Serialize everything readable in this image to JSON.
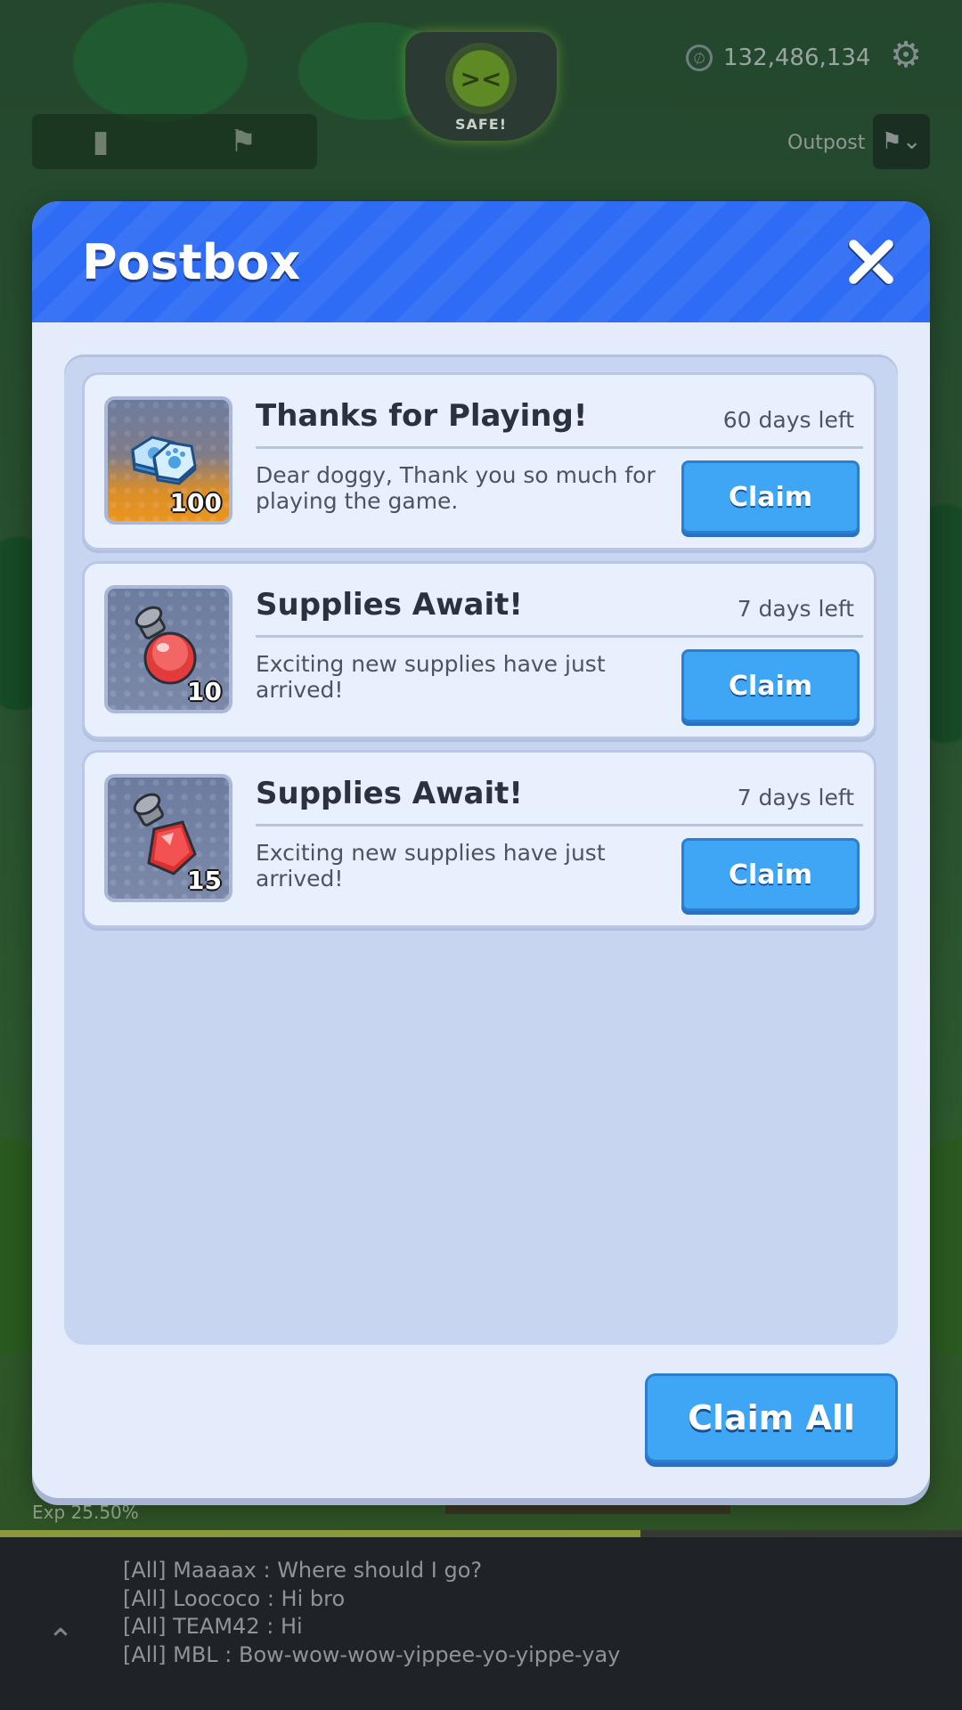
{
  "hud": {
    "safe_label": "SAFE!",
    "currency_value": "132,486,134",
    "outpost_label": "Outpost"
  },
  "postbox": {
    "title": "Postbox",
    "claim_all_label": "Claim All",
    "mails": [
      {
        "title": "Thanks for Playing!",
        "days_left": "60 days left",
        "body": "Dear doggy, Thank you so much for playing the game.",
        "item_icon": "paw-token-icon",
        "item_count": "100",
        "claim_label": "Claim"
      },
      {
        "title": "Supplies Await!",
        "days_left": "7 days left",
        "body": "Exciting new supplies have just arrived!",
        "item_icon": "round-red-potion-icon",
        "item_count": "10",
        "claim_label": "Claim"
      },
      {
        "title": "Supplies Await!",
        "days_left": "7 days left",
        "body": "Exciting new supplies have just arrived!",
        "item_icon": "square-red-potion-icon",
        "item_count": "15",
        "claim_label": "Claim"
      }
    ]
  },
  "exp": {
    "label": "Exp 25.50%",
    "fraction": 0.666
  },
  "chat": {
    "lines": [
      "[All] Maaaax : Where should I go?",
      "[All] Loococo : Hi bro",
      "[All] TEAM42 : Hi",
      "[All] MBL : Bow-wow-wow-yippee-yo-yippe-yay"
    ]
  },
  "colors": {
    "header_blue": "#2e6cf5",
    "claim_button": "#3fa6f5",
    "panel_background": "#e4ebfa"
  }
}
